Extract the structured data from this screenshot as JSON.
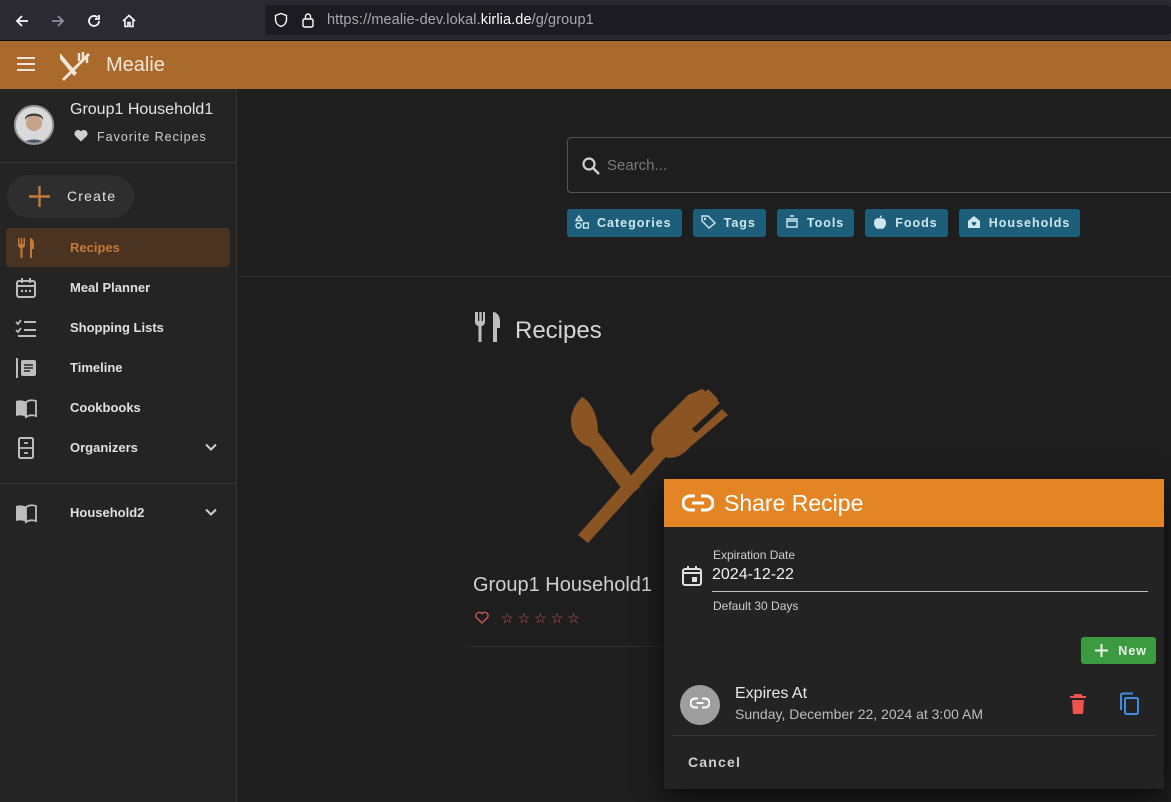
{
  "browser": {
    "url_prefix": "https://mealie-dev.lokal.",
    "url_domain": "kirlia.de",
    "url_path": "/g/group1"
  },
  "app": {
    "title": "Mealie",
    "accent": "#a96a2c"
  },
  "sidebar": {
    "user_name": "Group1 Household1",
    "favorites_label": "Favorite Recipes",
    "create_label": "Create",
    "items": [
      {
        "label": "Recipes",
        "icon": "fork-knife-icon",
        "active": true
      },
      {
        "label": "Meal Planner",
        "icon": "calendar-icon"
      },
      {
        "label": "Shopping Lists",
        "icon": "checklist-icon"
      },
      {
        "label": "Timeline",
        "icon": "timeline-icon"
      },
      {
        "label": "Cookbooks",
        "icon": "book-open-icon"
      },
      {
        "label": "Organizers",
        "icon": "file-cabinet-icon"
      }
    ],
    "household_label": "Household2"
  },
  "main": {
    "search_placeholder": "Search...",
    "chips": [
      "Categories",
      "Tags",
      "Tools",
      "Foods",
      "Households"
    ],
    "section_title": "Recipes",
    "card_title": "Group1 Household1"
  },
  "dialog": {
    "title": "Share Recipe",
    "expiration_label": "Expiration Date",
    "expiration_value": "2024-12-22",
    "expiration_hint": "Default 30 Days",
    "new_label": "New",
    "link_title": "Expires At",
    "link_subtitle": "Sunday, December 22, 2024 at 3:00 AM",
    "cancel_label": "Cancel",
    "header_color": "#e38524"
  }
}
